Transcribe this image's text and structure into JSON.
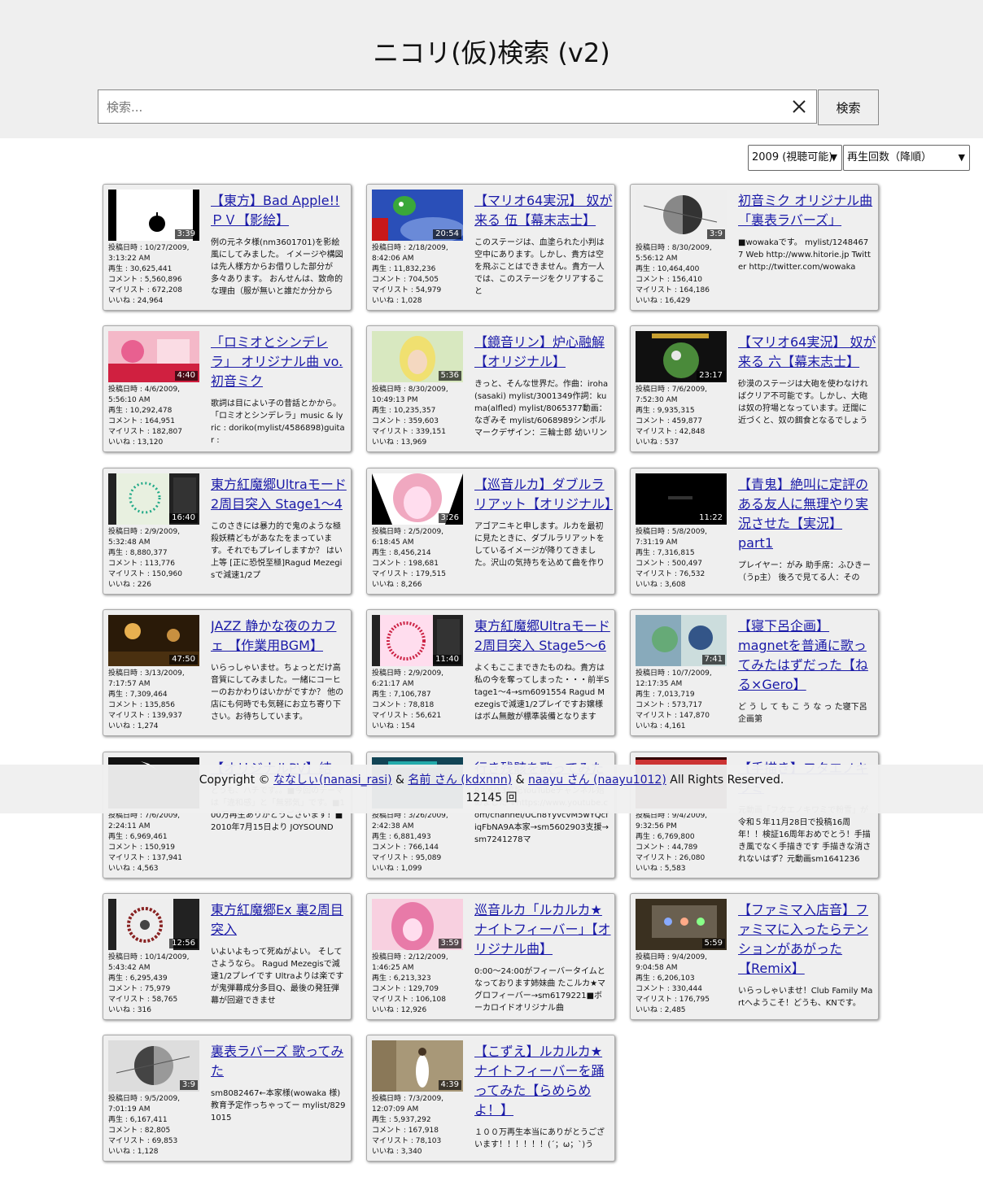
{
  "header": {
    "title": "ニコリ(仮)検索 (v2)",
    "search_placeholder": "検索...",
    "search_button": "検索"
  },
  "filters": {
    "year": "2009 (視聴可能)",
    "sort": "再生回数（降順）"
  },
  "labels": {
    "posted": "投稿日時 : ",
    "views": "再生 : ",
    "comments": "コメント : ",
    "mylist": "マイリスト : ",
    "likes": "いいね : "
  },
  "videos": [
    {
      "title": "【東方】Bad Apple!! ＰＶ【影絵】",
      "duration": "3:39",
      "date": "10/27/2009, 3:13:22 AM",
      "views": "30,625,441",
      "comments": "5,560,896",
      "mylist": "672,208",
      "likes": "24,964",
      "desc": "例の元ネタ様(nm3601701)を影絵風にしてみました。 イメージや構図は先人様方からお借りした部分が多々あります。 おんせんは、致命的な理由（服が無いと誰だか分から",
      "thumb": "badapple"
    },
    {
      "title": "【マリオ64実況】 奴が来る 伍【幕末志士】",
      "duration": "20:54",
      "date": "2/18/2009, 8:42:06 AM",
      "views": "11,832,236",
      "comments": "704,505",
      "mylist": "54,979",
      "likes": "1,028",
      "desc": "このステージは、血塗られた小判は空中にあります。しかし、貴方は空を飛ぶことはできません。貴方一人では、このステージをクリアすること",
      "thumb": "mario"
    },
    {
      "title": "初音ミク オリジナル曲 「裏表ラバーズ」",
      "duration": "3:9",
      "date": "8/30/2009, 5:56:12 AM",
      "views": "10,464,400",
      "comments": "156,410",
      "mylist": "164,186",
      "likes": "16,429",
      "desc": "■wowakaです。 mylist/12484677 Web http://www.hitorie.jp Twitter http://twitter.com/wowaka",
      "thumb": "urao"
    },
    {
      "title": "「ロミオとシンデレラ」 オリジナル曲 vo.初音ミク",
      "duration": "4:40",
      "date": "4/6/2009, 5:56:10 AM",
      "views": "10,292,478",
      "comments": "164,951",
      "mylist": "182,807",
      "likes": "13,120",
      "desc": "歌詞は目によい子の昔話とかから。「ロミオとシンデレラ」music & lyric : doriko(mylist/4586898)guitar :",
      "thumb": "romeo"
    },
    {
      "title": "【鏡音リン】炉心融解【オリジナル】",
      "duration": "5:36",
      "date": "8/30/2009, 10:49:13 PM",
      "views": "10,235,357",
      "comments": "359,603",
      "mylist": "339,151",
      "likes": "13,969",
      "desc": "きっと、そんな世界だ。作曲：iroha(sasaki) mylist/3001349作詞：kuma(alfled) mylist/8065377動画：なぎみそ mylist/6068989シンボルマークデザイン：三輪士郎 幼いリン",
      "thumb": "rin"
    },
    {
      "title": "【マリオ64実況】 奴が来る 六【幕末志士】",
      "duration": "23:17",
      "date": "7/6/2009, 7:52:30 AM",
      "views": "9,935,315",
      "comments": "459,877",
      "mylist": "42,848",
      "likes": "537",
      "desc": "砂漠のステージは大砲を使わなければクリア不可能です。しかし、大砲は奴の狩場となっています。迂闊に近づくと、奴の餌食となるでしょう",
      "thumb": "mario2"
    },
    {
      "title": "東方紅魔郷Ultraモード 2周目突入 Stage1～4",
      "duration": "16:40",
      "date": "2/9/2009, 5:32:48 AM",
      "views": "8,880,377",
      "comments": "113,776",
      "mylist": "150,960",
      "likes": "226",
      "desc": "このさきには暴力的で鬼のような極殺妖精どもがあなたをまっています。それでもプレイしますか？ はい 上等 [正に恐悦至極]Ragud Mezegisで減速1/2プ",
      "thumb": "touhou1"
    },
    {
      "title": "【巡音ルカ】ダブルラリアット【オリジナル】",
      "duration": "3:26",
      "date": "2/5/2009, 6:18:45 AM",
      "views": "8,456,214",
      "comments": "198,681",
      "mylist": "179,515",
      "likes": "8,266",
      "desc": "アゴアニキと申します。ルカを最初に見たときに、ダブルラリアットをしているイメージが降りてきました。沢山の気持ちを込めて曲を作り",
      "thumb": "luka"
    },
    {
      "title": "【青鬼】絶叫に定評のある友人に無理やり実況させた【実況】part1",
      "duration": "11:22",
      "date": "5/8/2009, 7:31:19 AM",
      "views": "7,316,815",
      "comments": "500,497",
      "mylist": "76,532",
      "likes": "3,608",
      "desc": "プレイヤー：がみ 助手席：ふひきー（うp主） 後ろで見てる人：その",
      "thumb": "aooni"
    },
    {
      "title": "JAZZ 静かな夜のカフェ 【作業用BGM】",
      "duration": "47:50",
      "date": "3/13/2009, 7:17:57 AM",
      "views": "7,309,464",
      "comments": "135,856",
      "mylist": "139,937",
      "likes": "1,274",
      "desc": "いらっしゃいませ。ちょっとだけ高音質にしてみました。一緒にコーヒーのおかわりはいかがですか？ 他の店にも何時でも気軽にお立ち寄り下さい。お待ちしています。",
      "thumb": "jazz"
    },
    {
      "title": "東方紅魔郷Ultraモード 2周目突入 Stage5～6",
      "duration": "11:40",
      "date": "2/9/2009, 6:21:17 AM",
      "views": "7,106,787",
      "comments": "78,818",
      "mylist": "56,621",
      "likes": "154",
      "desc": "よくもここまできたものね。貴方は私の今を奪ってしまった・・・前半Stage1～4→sm6091554 Ragud Mezegisで減速1/2プレイですお嬢様はボム無敵が標準装備となります",
      "thumb": "touhou2"
    },
    {
      "title": "【寝下呂企画】magnetを普通に歌ってみたはずだった【ねる×Gero】",
      "duration": "7:41",
      "date": "10/7/2009, 12:17:35 AM",
      "views": "7,013,719",
      "comments": "573,717",
      "mylist": "147,870",
      "likes": "4,161",
      "desc": "ど う し て も こ う な っ た寝下呂企画第",
      "thumb": "magnet"
    },
    {
      "title": "【オリジナルPV】結",
      "duration": "",
      "date": "7/6/2009, 2:24:11 AM",
      "views": "6,969,461",
      "comments": "150,919",
      "mylist": "137,941",
      "likes": "4,563",
      "desc": "どうも、ハチです。。■今回のテーマは「違和感」と「無邪気」です。■100万再生ありがとうございます！■2010年7月15日より JOYSOUND",
      "thumb": "dark"
    },
    {
      "title": "行き残骸を歌ってみた",
      "duration": "",
      "date": "3/26/2009, 2:42:38 AM",
      "views": "6,881,493",
      "comments": "766,144",
      "mylist": "95,089",
      "likes": "1,099",
      "desc": "R2/6/13追記YouTubeチャンネル始めました ↓https://www.youtube.com/channel/UCh8YyvcvM5wYQcfiqFbNA9A本家→sm5602903支援→sm7241278マ",
      "thumb": "teal"
    },
    {
      "title": "【手描き】フタエノキワミ",
      "duration": "",
      "date": "9/4/2009, 9:32:56 PM",
      "views": "6,769,800",
      "comments": "44,789",
      "mylist": "26,080",
      "likes": "5,583",
      "desc": "元動画「フタエノキワミで粉雪」が令和５年11月28日で投稿16周年！！検証16周年おめでとう！手描き風でなく手描きです 手描きな消されないはず？元動画sm1641236",
      "thumb": "red"
    },
    {
      "title": "東方紅魔郷Ex 裏2周目突入",
      "duration": "12:56",
      "date": "10/14/2009, 5:43:42 AM",
      "views": "6,295,439",
      "comments": "75,979",
      "mylist": "58,765",
      "likes": "316",
      "desc": "いよいよもって死ぬがよい。 そしてさようなら。 Ragud Mezegisで減速1/2プレイです Ultraよりは楽ですが鬼弾幕成分多目Q、最後の発狂弾幕が回避できませ",
      "thumb": "touhou3"
    },
    {
      "title": "巡音ルカ「ルカルカ★ナイトフィーバー」【オリジナル曲】",
      "duration": "3:59",
      "date": "2/12/2009, 1:46:25 AM",
      "views": "6,213,323",
      "comments": "129,709",
      "mylist": "106,108",
      "likes": "12,926",
      "desc": "0:00～24:00がフィーバータイムとなっております姉妹曲 たこルカ★マグロフィーバー→sm6179221■ボーカロイドオリジナル曲",
      "thumb": "lukaluka"
    },
    {
      "title": "【ファミマ入店音】ファミマに入ったらテンションがあがった【Remix】",
      "duration": "5:59",
      "date": "9/4/2009, 9:04:58 AM",
      "views": "6,206,103",
      "comments": "330,444",
      "mylist": "176,795",
      "likes": "2,485",
      "desc": "いらっしゃいませ！Club Family Martへようこそ！どうも、KNです。",
      "thumb": "famima"
    },
    {
      "title": "裏表ラバーズ 歌ってみた",
      "duration": "3:9",
      "date": "9/5/2009, 7:01:19 AM",
      "views": "6,167,411",
      "comments": "82,805",
      "mylist": "69,853",
      "likes": "1,128",
      "desc": "sm8082467←本家様(wowaka 様)教育予定作っちゃってー mylist/8291015",
      "thumb": "urao2"
    },
    {
      "title": "【こずえ】ルカルカ★ナイトフィーバーを踊ってみた【らめらめよ！】",
      "duration": "4:39",
      "date": "7/3/2009, 12:07:09 AM",
      "views": "5,937,292",
      "comments": "167,918",
      "mylist": "78,103",
      "likes": "3,340",
      "desc": "１００万再生本当にありがとうございます！！！！！！(´；ω；`)う",
      "thumb": "kozue"
    }
  ],
  "footer": {
    "copyright_prefix": "Copyright ©",
    "author1": "ななしぃ(nanasi_rasi)",
    "sep1": "&",
    "author2": "名前 さん (kdxnnn)",
    "sep2": "&",
    "author3": "naayu さん (naayu1012)",
    "rights": "All Rights Reserved.",
    "count": "12145 回"
  }
}
